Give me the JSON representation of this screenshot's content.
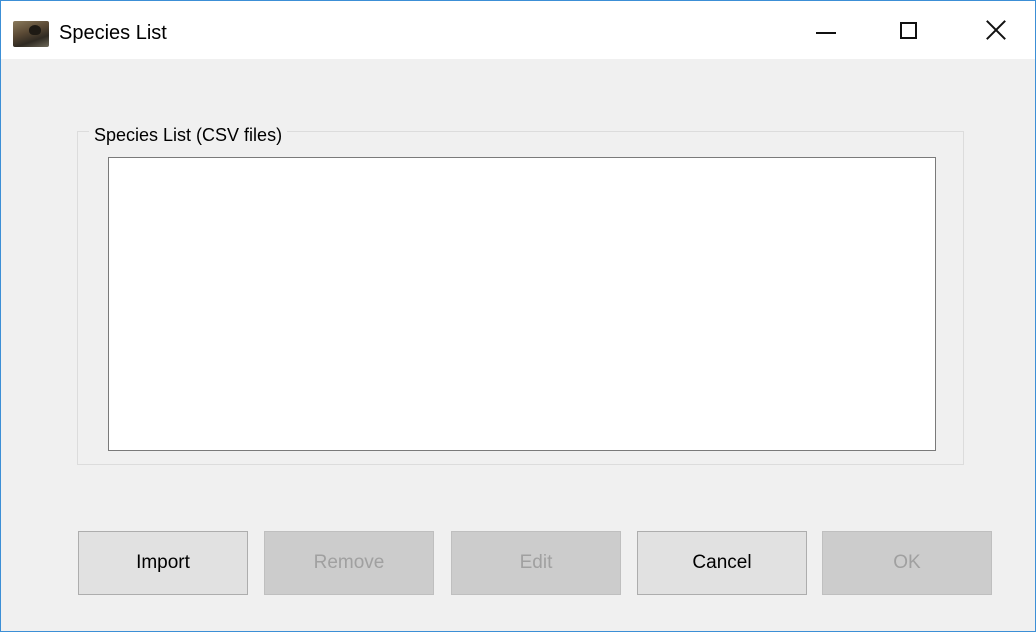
{
  "window": {
    "title": "Species List",
    "icon": "bird-photo-icon"
  },
  "caption_buttons": {
    "minimize": "minimize-icon",
    "maximize": "maximize-icon",
    "close": "close-icon"
  },
  "group": {
    "label": "Species List (CSV files)",
    "list_items": []
  },
  "buttons": {
    "import": {
      "label": "Import",
      "enabled": true
    },
    "remove": {
      "label": "Remove",
      "enabled": false
    },
    "edit": {
      "label": "Edit",
      "enabled": false
    },
    "cancel": {
      "label": "Cancel",
      "enabled": true
    },
    "ok": {
      "label": "OK",
      "enabled": false
    }
  },
  "colors": {
    "window_border": "#3c8fd6",
    "client_background": "#f0f0f0",
    "button_face": "#e1e1e1",
    "disabled_button_face": "#cccccc",
    "disabled_text": "#a0a0a0"
  }
}
